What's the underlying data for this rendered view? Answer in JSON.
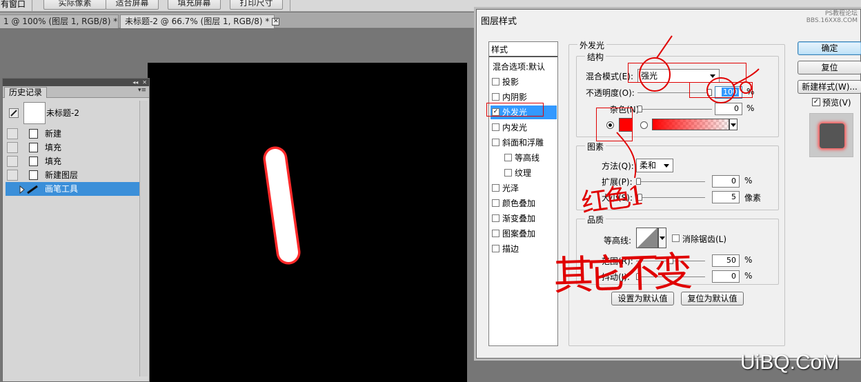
{
  "toolbar": {
    "left_label": "有窗口",
    "buttons": [
      "实际像素",
      "适合屏幕",
      "填充屏幕",
      "打印尺寸"
    ]
  },
  "tabs": [
    {
      "label": "1 @ 100% (图层 1, RGB/8) *",
      "close": "✕"
    },
    {
      "label": "未标题-2 @ 66.7% (图层 1, RGB/8) *",
      "close": "✕"
    }
  ],
  "history": {
    "panel_tab": "历史记录",
    "snapshot_label": "未标题-2",
    "rows": [
      {
        "label": "新建",
        "icon": "document-icon"
      },
      {
        "label": "填充",
        "icon": "fill-icon"
      },
      {
        "label": "填充",
        "icon": "fill-icon"
      },
      {
        "label": "新建图层",
        "icon": "document-icon"
      },
      {
        "label": "画笔工具",
        "icon": "brush-icon",
        "selected": true
      }
    ],
    "collapse_glyph": "◂◂",
    "close_glyph": "✕",
    "menu_glyph": "▾≡"
  },
  "dialog": {
    "title": "图层样式",
    "watermark_line1": "PS教程论坛",
    "watermark_line2": "BBS.16XX8.COM",
    "style_list": {
      "header": "样式",
      "blend_default": "混合选项:默认",
      "items": [
        {
          "label": "投影",
          "checked": false,
          "sub": false
        },
        {
          "label": "内阴影",
          "checked": false,
          "sub": false
        },
        {
          "label": "外发光",
          "checked": true,
          "sub": false,
          "selected": true
        },
        {
          "label": "内发光",
          "checked": false,
          "sub": false
        },
        {
          "label": "斜面和浮雕",
          "checked": false,
          "sub": false
        },
        {
          "label": "等高线",
          "checked": false,
          "sub": true
        },
        {
          "label": "纹理",
          "checked": false,
          "sub": true
        },
        {
          "label": "光泽",
          "checked": false,
          "sub": false
        },
        {
          "label": "颜色叠加",
          "checked": false,
          "sub": false
        },
        {
          "label": "渐变叠加",
          "checked": false,
          "sub": false
        },
        {
          "label": "图案叠加",
          "checked": false,
          "sub": false
        },
        {
          "label": "描边",
          "checked": false,
          "sub": false
        }
      ]
    },
    "outer_glow": {
      "section_title": "外发光",
      "structure": {
        "title": "结构",
        "blend_mode_label": "混合模式(E):",
        "blend_mode_value": "强光",
        "opacity_label": "不透明度(O):",
        "opacity_value": "100",
        "opacity_level": 1.0,
        "noise_label": "杂色(N):",
        "noise_value": "0",
        "noise_level": 0.0,
        "percent": "%",
        "glow_color": "#ff0000"
      },
      "elements": {
        "title": "图素",
        "method_label": "方法(Q):",
        "method_value": "柔和",
        "spread_label": "扩展(P):",
        "spread_value": "0",
        "spread_level": 0.0,
        "size_label": "大小(S):",
        "size_value": "5",
        "size_unit": "像素",
        "size_level": 0.02
      },
      "quality": {
        "title": "品质",
        "contour_label": "等高线:",
        "antialias_label": "消除锯齿(L)",
        "range_label": "范围(R):",
        "range_value": "50",
        "range_level": 0.5,
        "jitter_label": "抖动(J):",
        "jitter_value": "0",
        "jitter_level": 0.0
      },
      "set_default": "设置为默认值",
      "reset_default": "复位为默认值"
    },
    "buttons": {
      "ok": "确定",
      "reset": "复位",
      "new_style": "新建样式(W)...",
      "preview_label": "预览(V)",
      "preview_checked": true
    }
  },
  "annotations": {
    "note_red_color": "红色1",
    "note_other": "其它不变",
    "annotation_color": "#e00000"
  },
  "watermark_site": "UiBQ.CoM",
  "colors": {
    "selection_blue": "#3399ff",
    "history_sel": "#3b8fd9",
    "canvas_bg": "#000000"
  }
}
